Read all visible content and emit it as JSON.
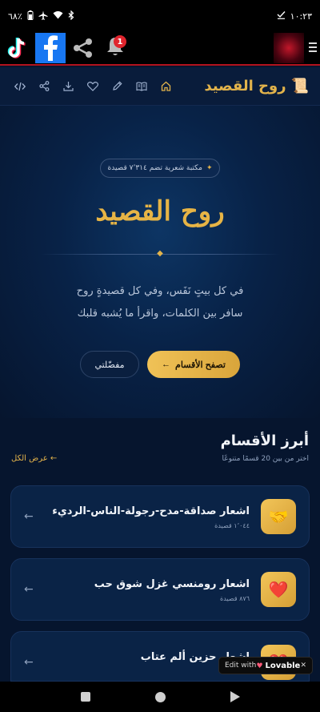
{
  "status_bar": {
    "time": "١٠:٢٣",
    "battery": "٦٨٪"
  },
  "browser_bar": {
    "notification_count": "1"
  },
  "app_header": {
    "brand": "روح القصيد",
    "scroll_icon": "📜"
  },
  "hero": {
    "pill_text": "مكتبة شعرية تضم ٧٬٣١٤ قصيدة",
    "title": "روح القصيد",
    "tagline_line1": "في كل بيتٍ نَفَس، وفي كل قصيدةٍ روح",
    "tagline_line2": "سافر بين الكلمات، واقرأ ما يُشبه قلبك",
    "primary_button": "تصفح الأقسام",
    "primary_arrow": "←",
    "secondary_button": "مفضّلتي"
  },
  "sections": {
    "title": "أبرز الأقسام",
    "subtitle": "اختر من بين 20 قسمًا متنوعًا",
    "see_all": "عرض الكل ←"
  },
  "categories": [
    {
      "title": "اشعار صداقة-مدح-رجولة-الناس-الرديء",
      "count": "١٬٠٤٤ قصيدة",
      "icon": "🤝"
    },
    {
      "title": "اشعار رومنسي غزل شوق حب",
      "count": "٨٧٦ قصيدة",
      "icon": "❤️"
    },
    {
      "title": "اشعار حزين ألم عتاب",
      "count": "",
      "icon": "💔"
    }
  ],
  "card_arrow": "←",
  "lovable": {
    "edit_with": "Edit with",
    "brand": "Lovable",
    "close": "✕"
  }
}
